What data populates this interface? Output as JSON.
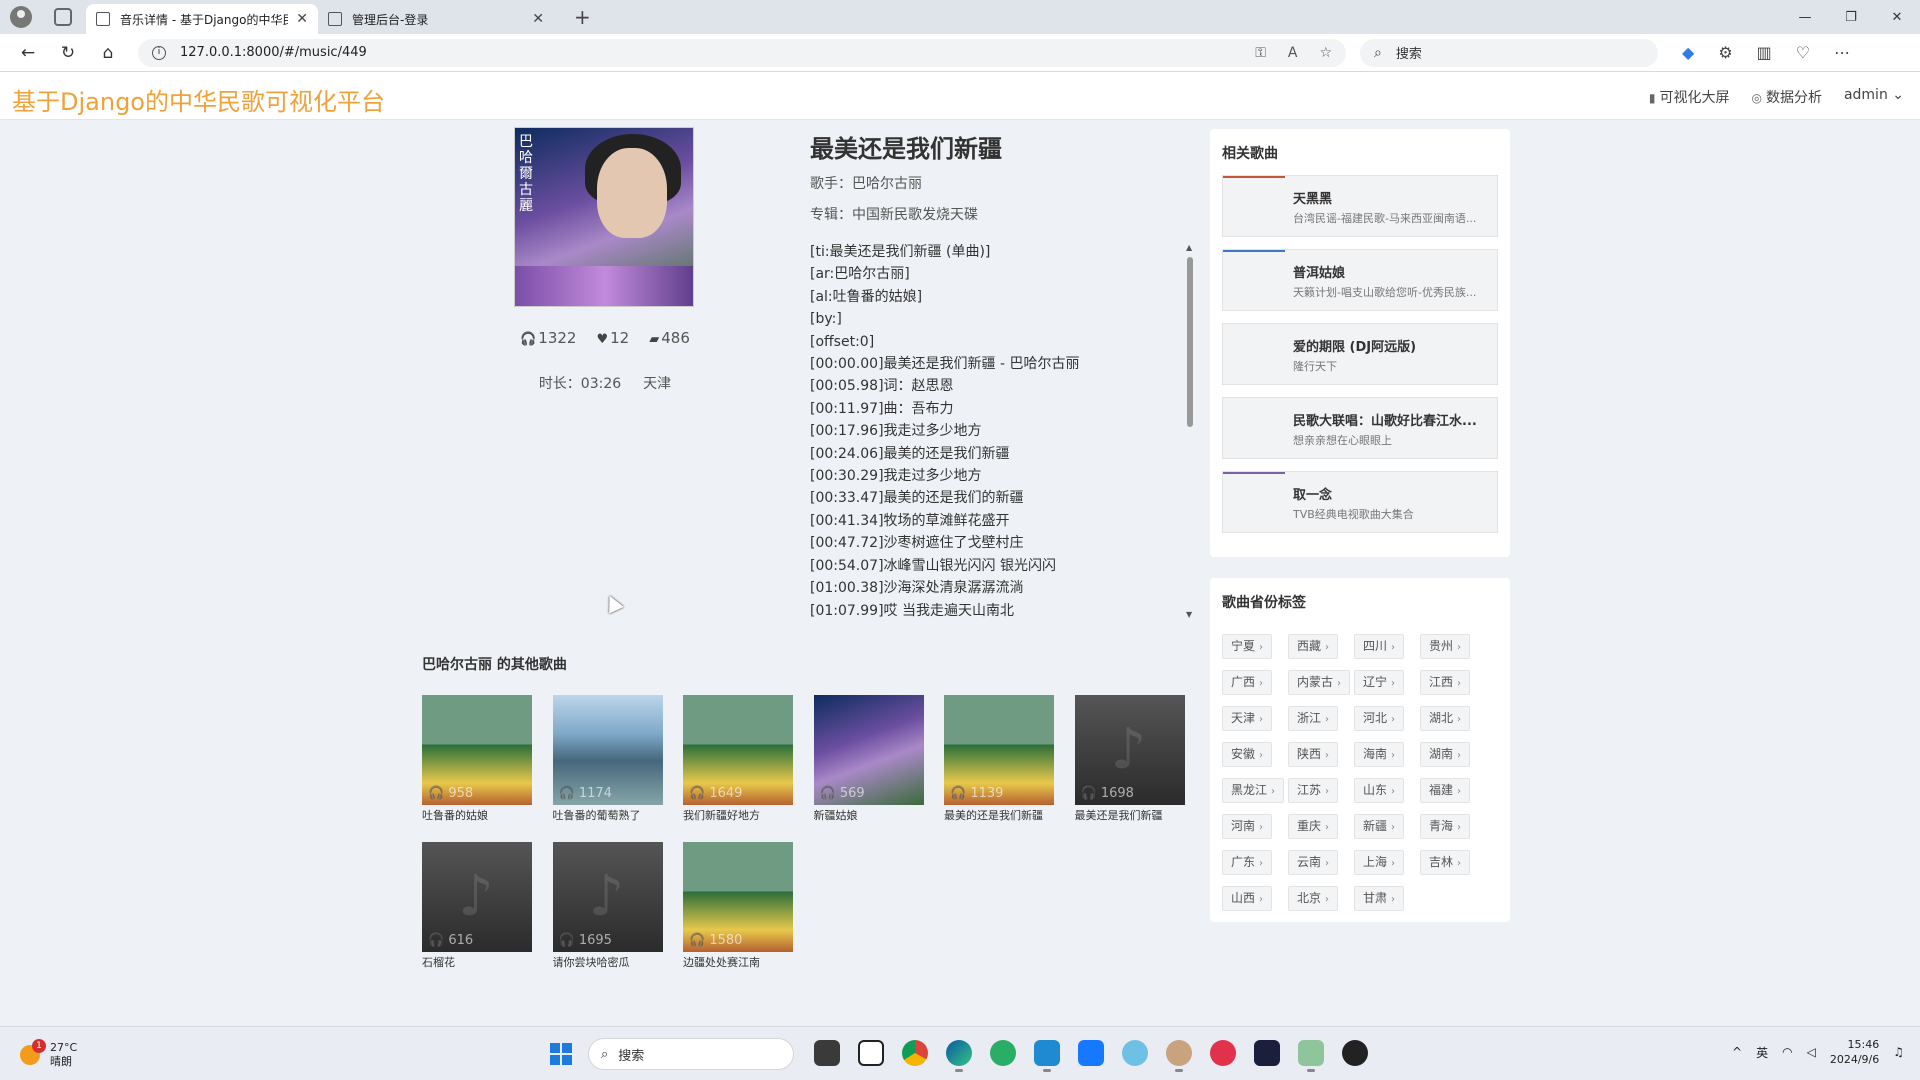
{
  "browser": {
    "tabs": [
      {
        "title": "音乐详情 - 基于Django的中华民歌",
        "active": true
      },
      {
        "title": "管理后台-登录",
        "active": false
      }
    ],
    "new_tab": "+",
    "url": "127.0.0.1:8000/#/music/449",
    "search_placeholder": "搜索",
    "window_controls": [
      "—",
      "❐",
      "✕"
    ]
  },
  "site": {
    "logo": "基于Django的中华民歌可视化平台",
    "nav": [
      {
        "icon": "bar-chart-icon",
        "label": "可视化大屏"
      },
      {
        "icon": "compass-icon",
        "label": "数据分析"
      },
      {
        "icon": "",
        "label": "admin ⌄"
      }
    ]
  },
  "song": {
    "title": "最美还是我们新疆",
    "singer": "歌手：巴哈尔古丽",
    "album": "专辑：中国新民歌发烧天碟",
    "plays": "1322",
    "likes": "12",
    "comments": "486",
    "duration": "时长：03:26",
    "region": "天津",
    "cover_text": "巴哈爾古麗"
  },
  "lyrics": [
    "[ti:最美还是我们新疆 (单曲)]",
    "[ar:巴哈尔古丽]",
    "[al:吐鲁番的姑娘]",
    "[by:]",
    "[offset:0]",
    "[00:00.00]最美还是我们新疆 - 巴哈尔古丽",
    "[00:05.98]词：赵思恩",
    "[00:11.97]曲：吾布力",
    "[00:17.96]我走过多少地方",
    "[00:24.06]最美的还是我们新疆",
    "[00:30.29]我走过多少地方",
    "[00:33.47]最美的还是我们的新疆",
    "[00:41.34]牧场的草滩鲜花盛开",
    "[00:47.72]沙枣树遮住了戈壁村庄",
    "[00:54.07]冰峰雪山银光闪闪 银光闪闪",
    "[01:00.38]沙海深处清泉潺潺流淌",
    "[01:07.99]哎 当我走遍天山南北"
  ],
  "other_songs": {
    "title": "巴哈尔古丽 的其他歌曲",
    "items": [
      {
        "name": "吐鲁番的姑娘",
        "plays": "958",
        "style": "green"
      },
      {
        "name": "吐鲁番的葡萄熟了",
        "plays": "1174",
        "style": "lake"
      },
      {
        "name": "我们新疆好地方",
        "plays": "1649",
        "style": "green"
      },
      {
        "name": "新疆姑娘",
        "plays": "569",
        "style": "singer"
      },
      {
        "name": "最美的还是我们新疆",
        "plays": "1139",
        "style": "green"
      },
      {
        "name": "最美还是我们新疆",
        "plays": "1698",
        "style": "dark"
      },
      {
        "name": "石榴花",
        "plays": "616",
        "style": "dark"
      },
      {
        "name": "请你尝块哈密瓜",
        "plays": "1695",
        "style": "dark"
      },
      {
        "name": "边疆处处赛江南",
        "plays": "1580",
        "style": "green"
      }
    ]
  },
  "related": {
    "title": "相关歌曲",
    "items": [
      {
        "title": "天黑黑",
        "sub": "台湾民谣-福建民歌-马来西亚闽南语...",
        "bar": "#c2553a"
      },
      {
        "title": "普洱姑娘",
        "sub": "天籁计划-唱支山歌给您听-优秀民族...",
        "bar": "#3f77c9"
      },
      {
        "title": "爱的期限 (DJ阿远版)",
        "sub": "隆行天下",
        "bar": ""
      },
      {
        "title": "民歌大联唱：山歌好比春江水...",
        "sub": "想亲亲想在心眼眼上",
        "bar": ""
      },
      {
        "title": "取一念",
        "sub": "TVB经典电视歌曲大集合",
        "bar": "#7b5fa8"
      }
    ]
  },
  "province_tags": {
    "title": "歌曲省份标签",
    "rows": [
      [
        "宁夏",
        "西藏",
        "四川",
        "贵州"
      ],
      [
        "广西",
        "内蒙古",
        "辽宁",
        "江西"
      ],
      [
        "天津",
        "浙江",
        "河北",
        "湖北"
      ],
      [
        "安徽",
        "陕西",
        "海南",
        "湖南"
      ],
      [
        "黑龙江",
        "江苏",
        "山东",
        "福建"
      ],
      [
        "河南",
        "重庆",
        "新疆",
        "青海"
      ],
      [
        "广东",
        "云南",
        "上海",
        "吉林"
      ],
      [
        "山西",
        "北京",
        "甘肃"
      ]
    ]
  },
  "taskbar": {
    "temp": "27°C",
    "weather": "晴朗",
    "weather_badge": "1",
    "search": "搜索",
    "ime": "英",
    "time": "15:46",
    "date": "2024/9/6"
  }
}
